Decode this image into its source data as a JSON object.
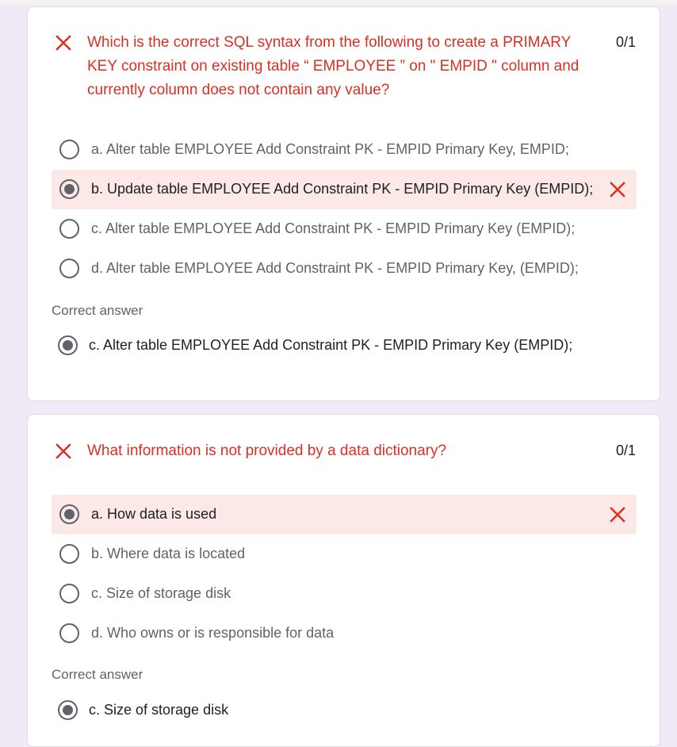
{
  "questions": [
    {
      "text": "Which is the correct SQL syntax from the following to create a PRIMARY KEY constraint on existing table “ EMPLOYEE ” on \" EMPID \" column and currently column does not contain any value?",
      "score": "0/1",
      "options": [
        {
          "label": "a. Alter table EMPLOYEE Add Constraint PK - EMPID Primary Key, EMPID;",
          "selected": false
        },
        {
          "label": "b. Update table EMPLOYEE Add Constraint PK - EMPID Primary Key (EMPID);",
          "selected": true
        },
        {
          "label": "c. Alter table EMPLOYEE Add Constraint PK - EMPID Primary Key (EMPID);",
          "selected": false
        },
        {
          "label": "d. Alter table EMPLOYEE Add Constraint PK - EMPID Primary Key, (EMPID);",
          "selected": false
        }
      ],
      "correct_answer_title": "Correct answer",
      "correct_answer": "c. Alter table EMPLOYEE Add Constraint PK - EMPID Primary Key (EMPID);"
    },
    {
      "text": "What information is not provided by a data dictionary?",
      "score": "0/1",
      "options": [
        {
          "label": "a. How data is used",
          "selected": true
        },
        {
          "label": "b. Where data is located",
          "selected": false
        },
        {
          "label": "c. Size of storage disk",
          "selected": false
        },
        {
          "label": "d. Who owns or is responsible for data",
          "selected": false
        }
      ],
      "correct_answer_title": "Correct answer",
      "correct_answer": "c. Size of storage disk"
    }
  ],
  "icons": {
    "incorrect": "close-icon",
    "radio": "radio-button-icon"
  },
  "colors": {
    "incorrect_red": "#d93025",
    "wrong_bg": "#fce8e6",
    "page_bg": "#efeaf6"
  }
}
